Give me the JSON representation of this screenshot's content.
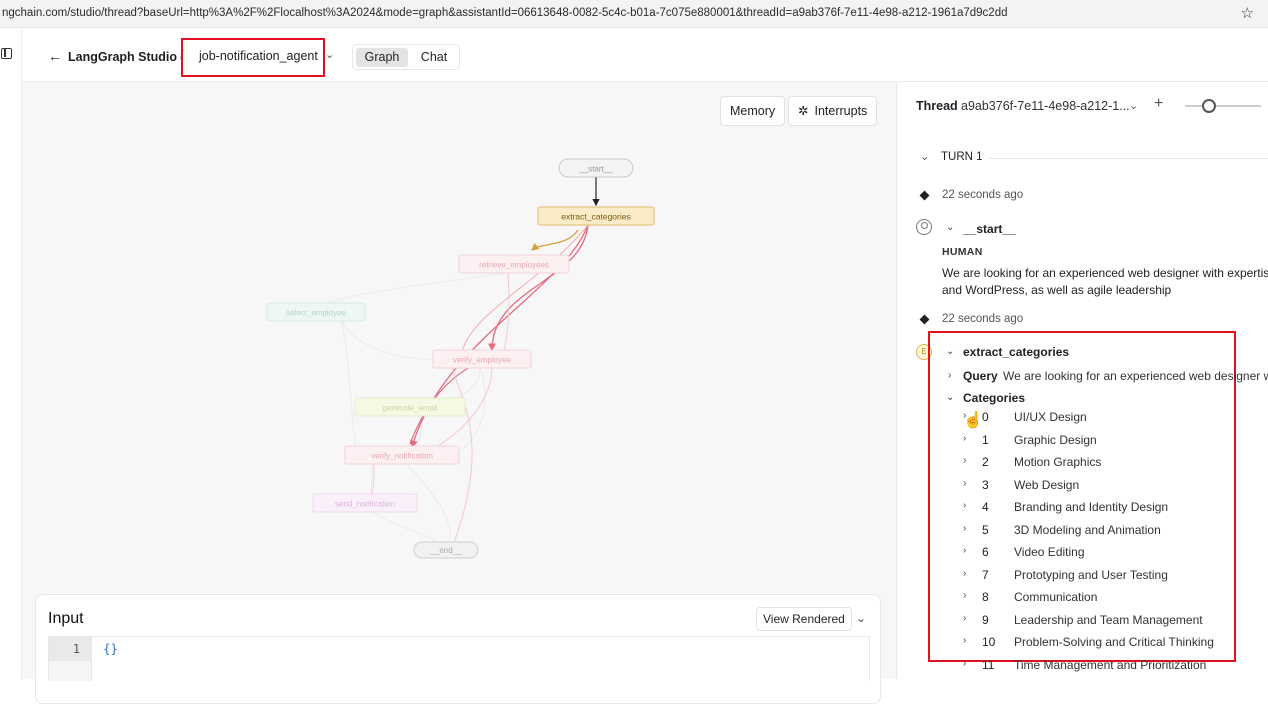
{
  "browser": {
    "url": "ngchain.com/studio/thread?baseUrl=http%3A%2F%2Flocalhost%3A2024&mode=graph&assistantId=06613648-0082-5c4c-b01a-7c075e880001&threadId=a9ab376f-7e11-4e98-a212-1961a7d9c2dd"
  },
  "header": {
    "back_label": "LangGraph Studio",
    "separator": "/",
    "agent_name": "job-notification_agent",
    "tabs": [
      "Graph",
      "Chat"
    ]
  },
  "graph": {
    "memory_label": "Memory",
    "interrupts_label": "Interrupts",
    "nodes": [
      "__start__",
      "extract_categories",
      "retrieve_employees",
      "select_employee",
      "verify_employee",
      "generate_email",
      "verify_notification",
      "send_notification",
      "__end__"
    ]
  },
  "input": {
    "title": "Input",
    "view_label": "View Rendered",
    "line_number": "1",
    "code": "{}"
  },
  "thread": {
    "label": "Thread",
    "id": "a9ab376f-7e11-4e98-a212-1...",
    "turn": "TURN 1",
    "start_time": "22 seconds ago",
    "start_node": "__start__",
    "role": "HUMAN",
    "message_line1": "We are looking for an experienced web designer with expertise",
    "message_line2": "and WordPress, as well as agile leadership",
    "step_time": "22 seconds ago",
    "step_icon": "E",
    "step_node": "extract_categories",
    "query_key": "Query",
    "query_value": "We are looking for an experienced web designer w",
    "categories_key": "Categories",
    "categories": [
      {
        "i": "0",
        "v": "UI/UX Design"
      },
      {
        "i": "1",
        "v": "Graphic Design"
      },
      {
        "i": "2",
        "v": "Motion Graphics"
      },
      {
        "i": "3",
        "v": "Web Design"
      },
      {
        "i": "4",
        "v": "Branding and Identity Design"
      },
      {
        "i": "5",
        "v": "3D Modeling and Animation"
      },
      {
        "i": "6",
        "v": "Video Editing"
      },
      {
        "i": "7",
        "v": "Prototyping and User Testing"
      },
      {
        "i": "8",
        "v": "Communication"
      },
      {
        "i": "9",
        "v": "Leadership and Team Management"
      },
      {
        "i": "10",
        "v": "Problem-Solving and Critical Thinking"
      },
      {
        "i": "11",
        "v": "Time Management and Prioritization"
      }
    ]
  }
}
